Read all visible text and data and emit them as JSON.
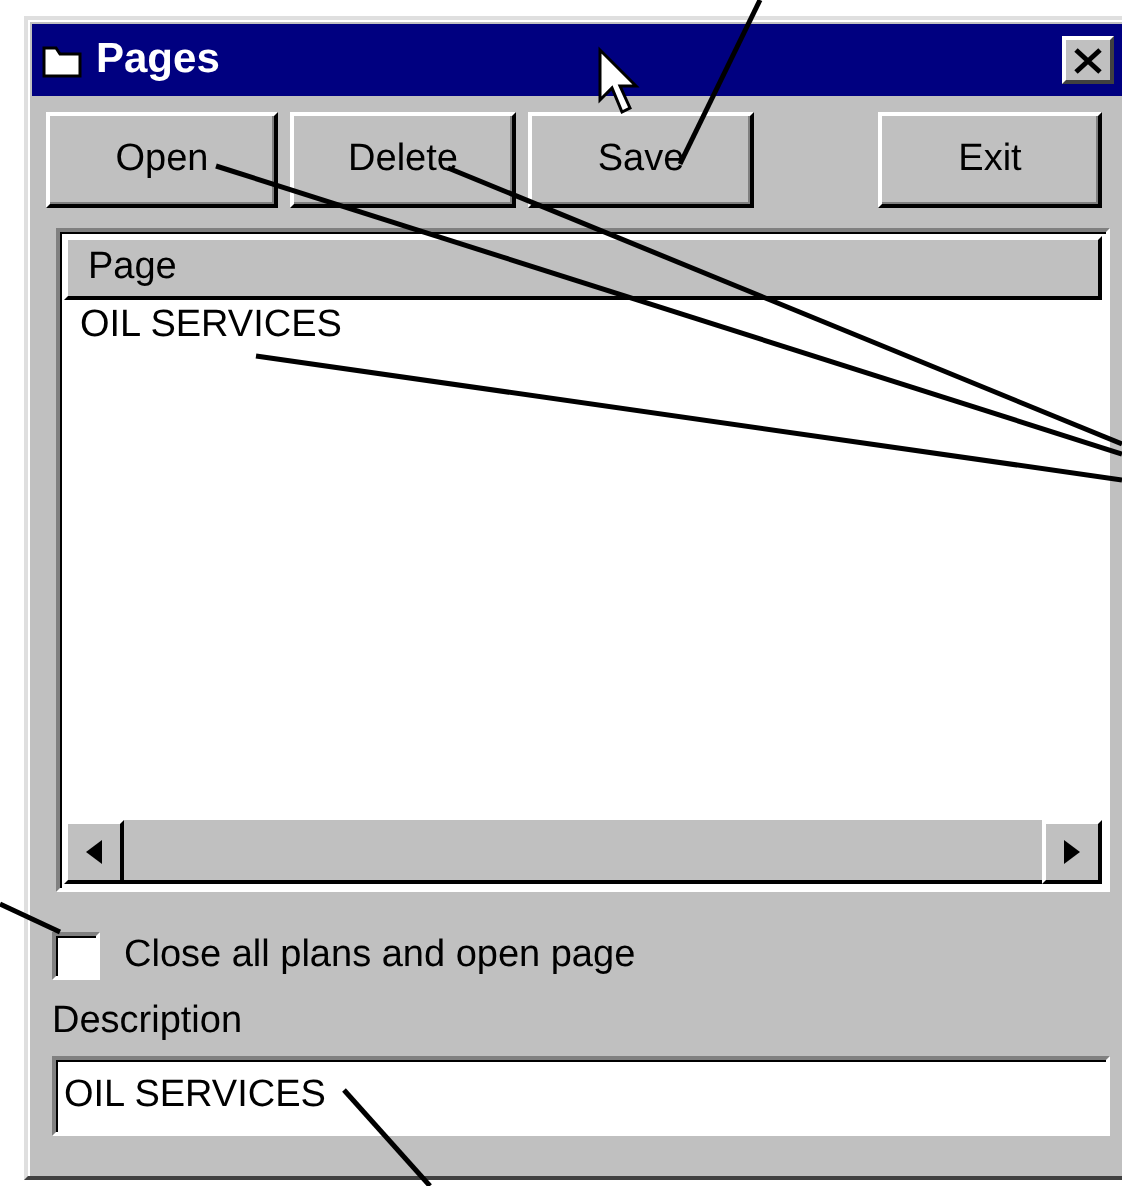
{
  "window": {
    "title": "Pages"
  },
  "buttons": [
    {
      "label": "Open"
    },
    {
      "label": "Delete"
    },
    {
      "label": "Save"
    },
    {
      "label": "Exit"
    }
  ],
  "list": {
    "columns": [
      "Page"
    ],
    "rows": [
      {
        "cells": [
          "OIL SERVICES"
        ],
        "selected": false
      }
    ]
  },
  "checkbox": {
    "label": "Close all plans and open page",
    "checked": false
  },
  "description": {
    "label": "Description",
    "value": "OIL SERVICES"
  }
}
